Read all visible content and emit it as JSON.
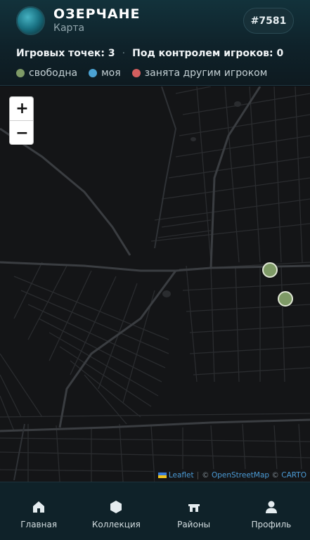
{
  "header": {
    "title": "ОЗЕРЧАНЕ",
    "subtitle": "Карта",
    "id_badge": "#7581"
  },
  "stats": {
    "points": "Игровых точек: 3",
    "separator": "·",
    "controlled": "Под контролем игроков: 0"
  },
  "legend": [
    {
      "label": "свободна",
      "color": "#7e9a66"
    },
    {
      "label": "моя",
      "color": "#4ba3d4"
    },
    {
      "label": "занята другим игроком",
      "color": "#d35f5f"
    }
  ],
  "map": {
    "zoom_in": "+",
    "zoom_out": "−",
    "attribution": {
      "leaflet": "Leaflet",
      "pipe": "|",
      "copy1": "©",
      "osm": "OpenStreetMap",
      "copy2": "©",
      "carto": "CARTO"
    },
    "marker_color": "#7e9a66"
  },
  "nav": [
    {
      "label": "Главная",
      "icon": "home-icon"
    },
    {
      "label": "Коллекция",
      "icon": "hexagon-icon"
    },
    {
      "label": "Районы",
      "icon": "gate-icon"
    },
    {
      "label": "Профиль",
      "icon": "user-icon"
    }
  ]
}
